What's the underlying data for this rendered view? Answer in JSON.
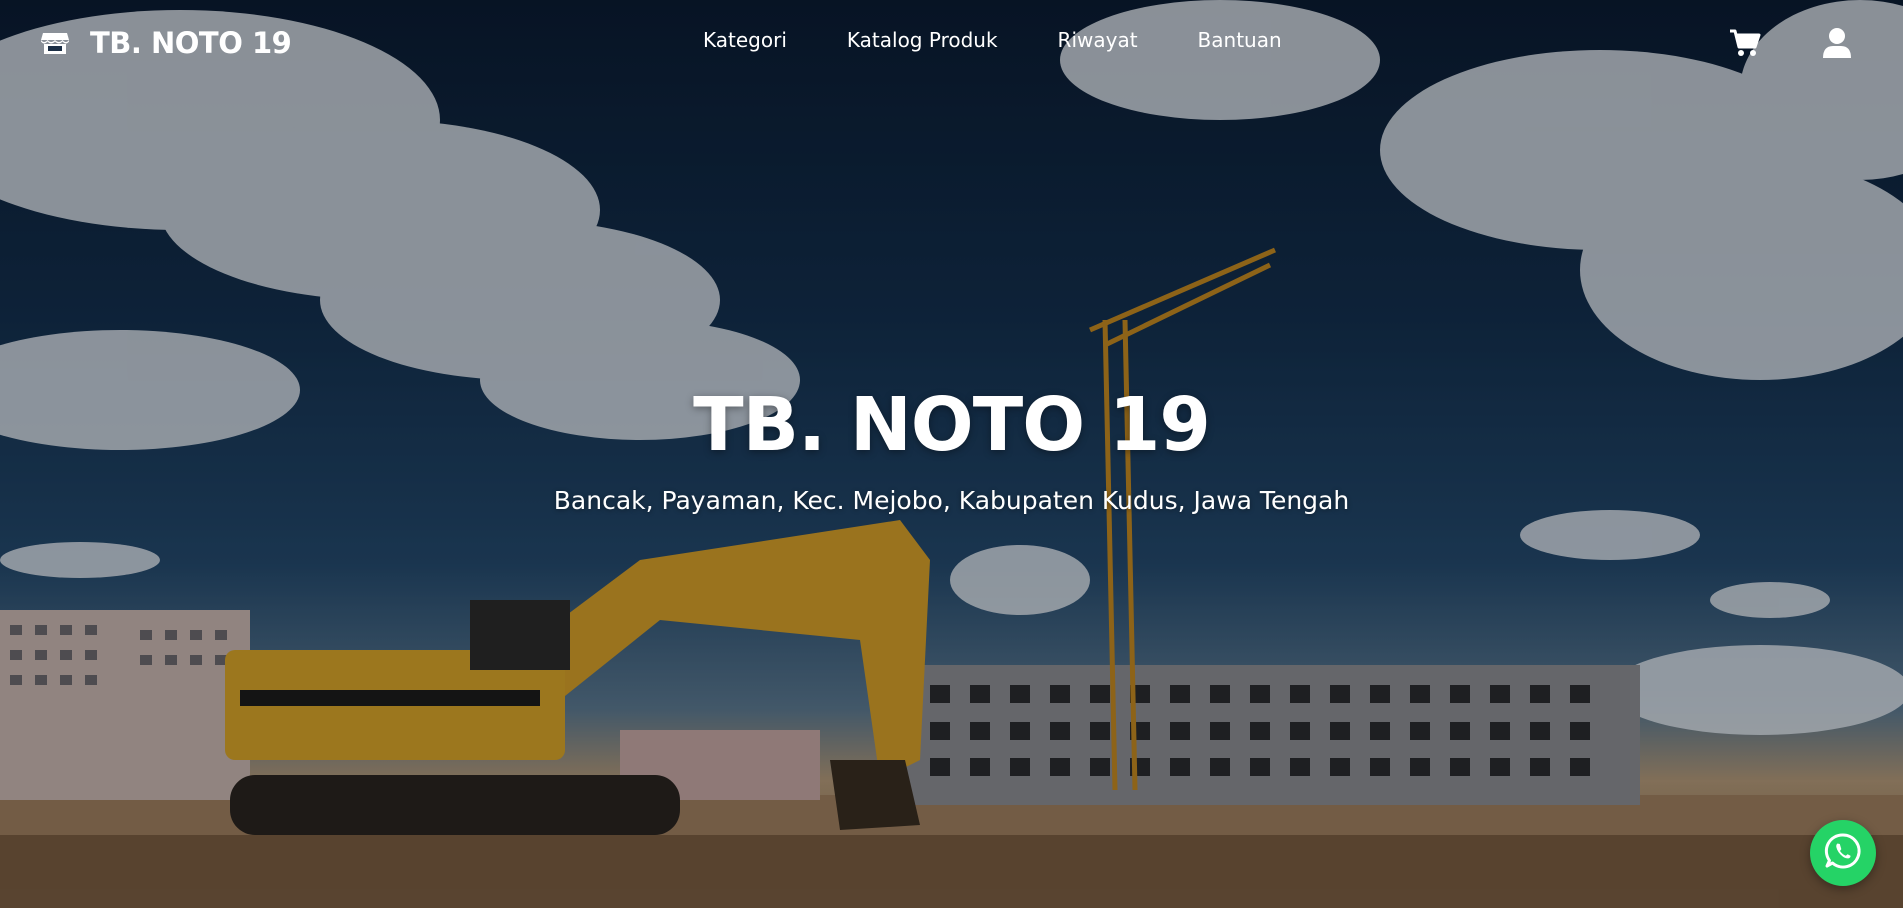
{
  "brand": {
    "name": "TB. NOTO 19",
    "icon": "store-icon"
  },
  "nav": {
    "items": [
      {
        "label": "Kategori"
      },
      {
        "label": "Katalog Produk"
      },
      {
        "label": "Riwayat"
      },
      {
        "label": "Bantuan"
      }
    ],
    "cart_icon": "shopping-cart-icon",
    "user_icon": "user-icon"
  },
  "hero": {
    "title": "TB. NOTO 19",
    "subtitle": "Bancak, Payaman, Kec. Mejobo, Kabupaten Kudus, Jawa Tengah",
    "background": "construction-site-excavator-crane-photo"
  },
  "whatsapp": {
    "icon": "whatsapp-icon",
    "color": "#25d366"
  }
}
